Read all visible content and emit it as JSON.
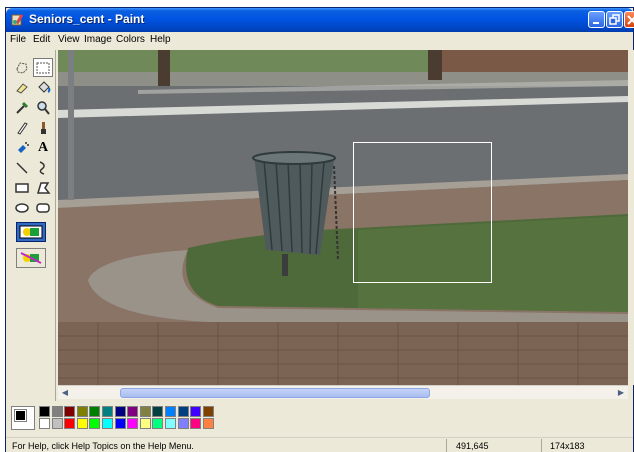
{
  "window": {
    "title": "Seniors_cent - Paint"
  },
  "menu": [
    "File",
    "Edit",
    "View",
    "Image",
    "Colors",
    "Help"
  ],
  "tools": [
    {
      "name": "free-form-select-icon"
    },
    {
      "name": "rectangle-select-icon",
      "selected": true
    },
    {
      "name": "eraser-icon"
    },
    {
      "name": "fill-bucket-icon"
    },
    {
      "name": "color-picker-icon"
    },
    {
      "name": "magnifier-icon"
    },
    {
      "name": "pencil-icon"
    },
    {
      "name": "brush-icon"
    },
    {
      "name": "airbrush-icon"
    },
    {
      "name": "text-icon"
    },
    {
      "name": "line-icon"
    },
    {
      "name": "curve-icon"
    },
    {
      "name": "rectangle-icon"
    },
    {
      "name": "polygon-icon"
    },
    {
      "name": "ellipse-icon"
    },
    {
      "name": "rounded-rectangle-icon"
    }
  ],
  "toolbox_text_glyph": "A",
  "palette": {
    "foreground": "#000000",
    "background": "#ffffff",
    "top_row": [
      "#000000",
      "#808080",
      "#800000",
      "#808000",
      "#008000",
      "#008080",
      "#000080",
      "#800080",
      "#808040",
      "#004040",
      "#0080ff",
      "#004080",
      "#4000ff",
      "#804000"
    ],
    "bottom_row": [
      "#ffffff",
      "#c0c0c0",
      "#ff0000",
      "#ffff00",
      "#00ff00",
      "#00ffff",
      "#0000ff",
      "#ff00ff",
      "#ffff80",
      "#00ff80",
      "#80ffff",
      "#8080ff",
      "#ff0080",
      "#ff8040"
    ]
  },
  "status": {
    "help": "For Help, click Help Topics on the Help Menu.",
    "cursor_pos": "491,645",
    "selection_size": "174x183"
  }
}
